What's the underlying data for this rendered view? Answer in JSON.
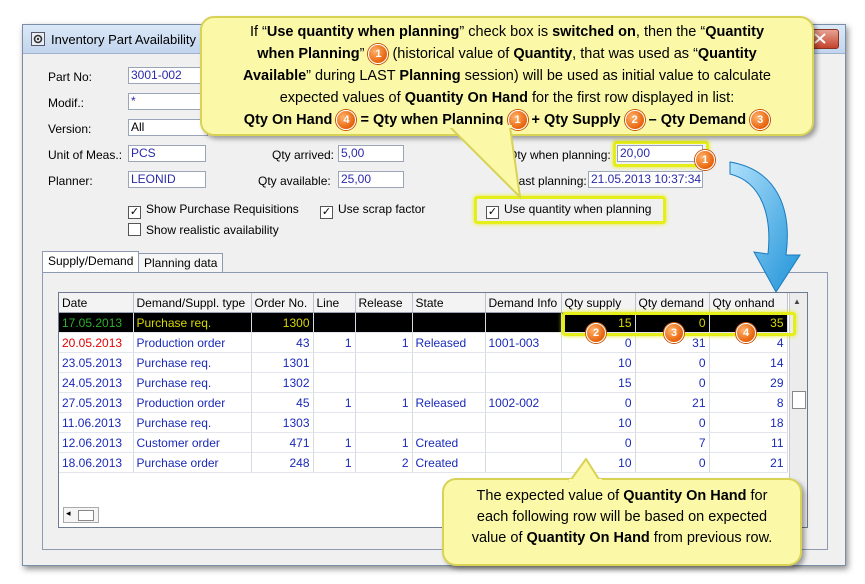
{
  "window": {
    "title": "Inventory Part Availability"
  },
  "form": {
    "part_no_label": "Part No:",
    "part_no": "3001-002",
    "modif_label": "Modif.:",
    "modif": "*",
    "version_label": "Version:",
    "version": "All",
    "uom_label": "Unit of Meas.:",
    "uom": "PCS",
    "planner_label": "Planner:",
    "planner": "LEONID",
    "qty_arrived_label": "Qty arrived:",
    "qty_arrived": "5,00",
    "qty_available_label": "Qty available:",
    "qty_available": "25,00",
    "qty_when_planning_label": "Qty when planning:",
    "qty_when_planning": "20,00",
    "last_planning_label": "Last planning:",
    "last_planning": "21.05.2013 10:37:34"
  },
  "checkboxes": {
    "show_purchase_requisitions": {
      "label": "Show Purchase Requisitions",
      "checked": true
    },
    "use_scrap_factor": {
      "label": "Use scrap factor",
      "checked": true
    },
    "use_quantity_when_planning": {
      "label": "Use quantity when planning",
      "checked": true
    },
    "show_realistic_availability": {
      "label": "Show realistic availability",
      "checked": false
    }
  },
  "tabs": [
    {
      "label": "Supply/Demand",
      "active": true
    },
    {
      "label": "Planning data",
      "active": false
    }
  ],
  "grid": {
    "columns": [
      "Date",
      "Demand/Suppl. type",
      "Order No.",
      "Line",
      "Release",
      "State",
      "Demand Info",
      "Qty supply",
      "Qty demand",
      "Qty onhand"
    ],
    "rows": [
      [
        "17.05.2013",
        "Purchase req.",
        "1300",
        "",
        "",
        "",
        "",
        "15",
        "0",
        "35"
      ],
      [
        "20.05.2013",
        "Production order",
        "43",
        "1",
        "1",
        "Released",
        "1001-003",
        "0",
        "31",
        "4"
      ],
      [
        "23.05.2013",
        "Purchase req.",
        "1301",
        "",
        "",
        "",
        "",
        "10",
        "0",
        "14"
      ],
      [
        "24.05.2013",
        "Purchase req.",
        "1302",
        "",
        "",
        "",
        "",
        "15",
        "0",
        "29"
      ],
      [
        "27.05.2013",
        "Production order",
        "45",
        "1",
        "1",
        "Released",
        "1002-002",
        "0",
        "21",
        "8"
      ],
      [
        "11.06.2013",
        "Purchase req.",
        "1303",
        "",
        "",
        "",
        "",
        "10",
        "0",
        "18"
      ],
      [
        "12.06.2013",
        "Customer order",
        "471",
        "1",
        "1",
        "Created",
        "",
        "0",
        "7",
        "11"
      ],
      [
        "18.06.2013",
        "Purchase order",
        "248",
        "1",
        "2",
        "Created",
        "",
        "10",
        "0",
        "21"
      ]
    ]
  },
  "callout_top": {
    "line1_a": "If “",
    "line1_b": "Use quantity when planning",
    "line1_c": "” check box is ",
    "line1_d": "switched on",
    "line1_e": ", then the “",
    "line1_f": "Quantity",
    "line2_a": "when Planning",
    "line2_b": "” ",
    "line2_c": " (historical value of ",
    "line2_d": "Quantity",
    "line2_e": ", that was used as “",
    "line2_f": "Quantity",
    "line3_a": "Available",
    "line3_b": "” during LAST ",
    "line3_c": "Planning",
    "line3_d": " session) will be used as initial value to calculate",
    "line4_a": "expected values of ",
    "line4_b": "Quantity On Hand",
    "line4_c": " for the first row displayed in list:",
    "formula_a": "Qty On Hand",
    "formula_b": " = Qty when Planning",
    "formula_c": " + Qty Supply",
    "formula_d": " – Qty Demand"
  },
  "callout_bottom": {
    "line1_a": "The expected value of ",
    "line1_b": "Quantity On Hand",
    "line1_c": " for",
    "line2": "each following row will be based on expected",
    "line3_a": "value of ",
    "line3_b": "Quantity On Hand",
    "line3_c": " from previous row."
  },
  "badges": {
    "one": "1",
    "two": "2",
    "three": "3",
    "four": "4"
  },
  "colors": {
    "callout_bg": "#fbf9a8",
    "highlight": "#e6ee1a",
    "badge": "#e8620a",
    "arrow": "#2aa6e6"
  }
}
